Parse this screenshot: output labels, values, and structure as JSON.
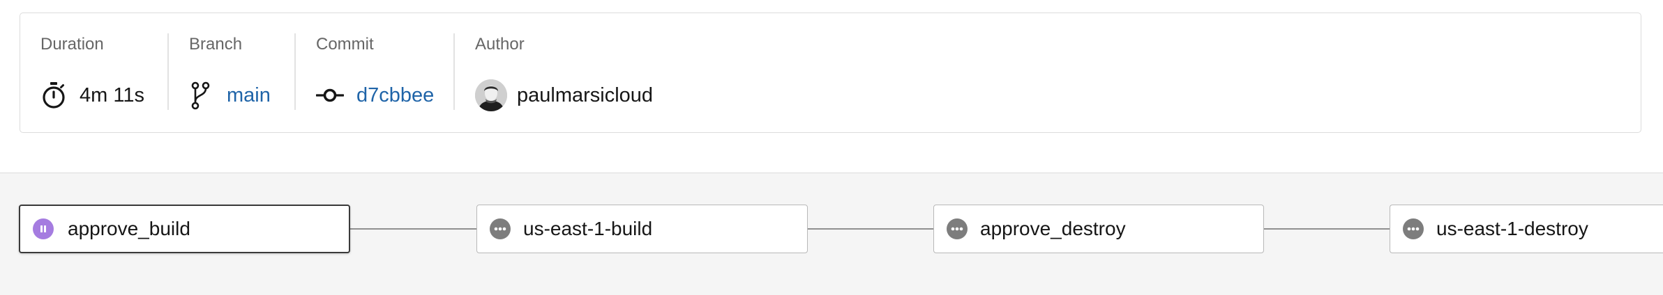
{
  "summary": {
    "duration": {
      "label": "Duration",
      "value": "4m 11s",
      "icon": "stopwatch-icon"
    },
    "branch": {
      "label": "Branch",
      "value": "main",
      "icon": "git-branch-icon"
    },
    "commit": {
      "label": "Commit",
      "value": "d7cbbee",
      "icon": "git-commit-icon"
    },
    "author": {
      "label": "Author",
      "value": "paulmarsicloud",
      "icon": "avatar"
    }
  },
  "workflow": {
    "jobs": [
      {
        "name": "approve_build",
        "status": "paused",
        "icon": "pause-icon",
        "selected": true
      },
      {
        "name": "us-east-1-build",
        "status": "pending",
        "icon": "more-horizontal-icon"
      },
      {
        "name": "approve_destroy",
        "status": "pending",
        "icon": "more-horizontal-icon"
      },
      {
        "name": "us-east-1-destroy",
        "status": "pending",
        "icon": "more-horizontal-icon"
      }
    ]
  },
  "colors": {
    "link": "#1f64a8",
    "paused_status": "#a57ce0",
    "pending_status": "#7d7d7d"
  }
}
